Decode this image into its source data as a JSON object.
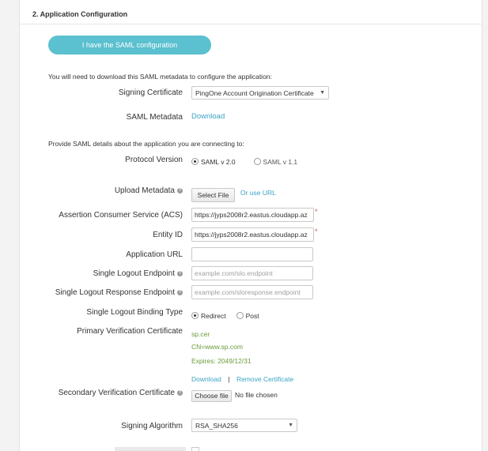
{
  "section": {
    "title": "2. Application Configuration"
  },
  "saml_button": {
    "label": "I have the SAML configuration"
  },
  "intro_download": "You will need to download this SAML metadata to configure the application:",
  "signing_certificate": {
    "label": "Signing Certificate",
    "value": "PingOne Account Origination Certificate"
  },
  "saml_metadata": {
    "label": "SAML Metadata",
    "link": "Download"
  },
  "intro_details": "Provide SAML details about the application you are connecting to:",
  "protocol_version": {
    "label": "Protocol Version",
    "opt1": "SAML v 2.0",
    "opt2": "SAML v 1.1",
    "selected": "SAML v 2.0"
  },
  "upload_metadata": {
    "label": "Upload Metadata",
    "button": "Select File",
    "link": "Or use URL"
  },
  "acs": {
    "label": "Assertion Consumer Service (ACS)",
    "value": "https://jyps2008r2.eastus.cloudapp.az",
    "required": "*"
  },
  "entity_id": {
    "label": "Entity ID",
    "value": "https://jyps2008r2.eastus.cloudapp.az",
    "required": "*"
  },
  "application_url": {
    "label": "Application URL",
    "value": ""
  },
  "slo_endpoint": {
    "label": "Single Logout Endpoint",
    "placeholder": "example.com/slo.endpoint"
  },
  "slo_response": {
    "label": "Single Logout Response Endpoint",
    "placeholder": "example.com/sloresponse.endpoint"
  },
  "slo_binding": {
    "label": "Single Logout Binding Type",
    "opt1": "Redirect",
    "opt2": "Post",
    "selected": "Redirect"
  },
  "primary_cert": {
    "label": "Primary Verification Certificate",
    "file": "sp.cer",
    "cn": "CN=www.sp.com",
    "expires": "Expires: 2049/12/31",
    "download": "Download",
    "separator": "|",
    "remove": "Remove Certificate"
  },
  "secondary_cert": {
    "label": "Secondary Verification Certificate",
    "button": "Choose file",
    "status": "No file chosen"
  },
  "signing_algorithm": {
    "label": "Signing Algorithm",
    "value": "RSA_SHA256"
  },
  "icons": {
    "help": "question-circle-icon",
    "dropdown": "caret-down-icon"
  },
  "colors": {
    "accent": "#5bc0cf",
    "link": "#3aa3c4",
    "cert_text": "#6a9a3a",
    "required": "#d9534f"
  }
}
